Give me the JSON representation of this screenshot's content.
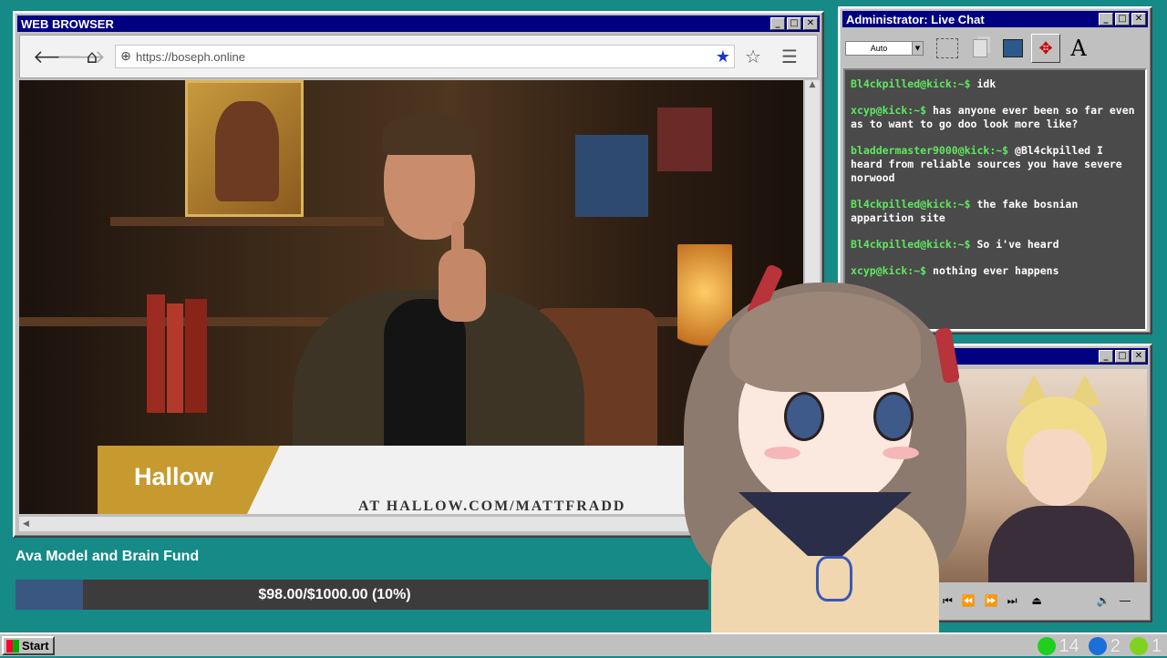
{
  "browser": {
    "title": "WEB BROWSER",
    "url": "https://boseph.online",
    "nav": {
      "back": "back-icon",
      "forward": "forward-icon",
      "home": "home-icon"
    },
    "video": {
      "banner_brand": "Hallow",
      "banner_url": "AT HALLOW.COM/MATTFRADD"
    }
  },
  "fund": {
    "title": "Ava Model and Brain Fund",
    "progress_text": "$98.00/$1000.00 (10%)",
    "progress_fraction": 0.098
  },
  "chat": {
    "title": "Administrator: Live Chat",
    "zoom_select": "Auto",
    "messages": [
      {
        "user": "Bl4ckpilled@kick:~$",
        "text": "idk"
      },
      {
        "user": "xcyp@kick:~$",
        "text": "has anyone ever been so far even as to want to go doo look more like?"
      },
      {
        "user": "bladdermaster9000@kick:~$",
        "text": "@Bl4ckpilled I heard from reliable sources you have severe norwood"
      },
      {
        "user": "Bl4ckpilled@kick:~$",
        "text": "the fake bosnian apparition site"
      },
      {
        "user": "Bl4ckpilled@kick:~$",
        "text": "So i've heard"
      },
      {
        "user": "xcyp@kick:~$",
        "text": "nothing ever happens"
      }
    ]
  },
  "avatar_window": {
    "title": ""
  },
  "taskbar": {
    "start_label": "Start",
    "tray": [
      {
        "icon": "kick-icon",
        "color": "#1fd01f",
        "count": "14"
      },
      {
        "icon": "moon-icon",
        "color": "#1a6fd8",
        "count": "2"
      },
      {
        "icon": "play-icon",
        "color": "#7ed321",
        "count": "1"
      }
    ]
  },
  "colors": {
    "desktop": "#158a86",
    "titlebar": "#000080",
    "chat_user": "#5fe85f",
    "fund_fill": "#3a5781"
  }
}
